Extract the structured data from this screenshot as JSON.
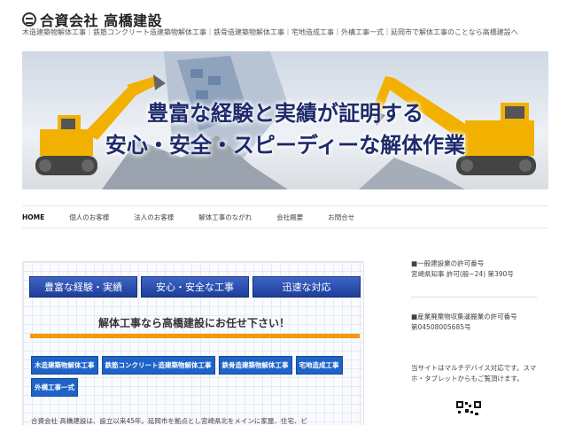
{
  "header": {
    "title": "合資会社 高橋建設",
    "description": "木造建築物解体工事｜鉄筋コンクリート造建築物解体工事｜鉄骨造建築物解体工事｜宅地造成工事｜外構工事一式｜延岡市で解体工事のことなら高橋建設へ"
  },
  "hero": {
    "line1": "豊富な経験と実績が証明する",
    "line2": "安心・安全・スピーディーな解体作業"
  },
  "nav": {
    "items": [
      "HOME",
      "個人のお客様",
      "法人のお客様",
      "解体工事のながれ",
      "会社概要",
      "お問合せ"
    ]
  },
  "content": {
    "headings": [
      "豊富な経験・実績",
      "安心・安全な工事",
      "迅速な対応"
    ],
    "promo": "解体工事なら高橋建設にお任せ下さい！",
    "services": [
      "木造建築物解体工事",
      "鉄筋コンクリート造建築物解体工事",
      "鉄骨造建築物解体工事",
      "宅地造成工事",
      "外構工事一式"
    ],
    "intro": "合資会社 高橋建設は、設立以来45年。延岡市を拠点とし宮崎県北をメインに家屋、住宅、ビ"
  },
  "sidebar": {
    "permit1_title": "■一般建設業の許可番号",
    "permit1_value": "宮崎県知事 許可(般−24) 第390号",
    "permit2_title": "■産業廃棄物収集運搬業の許可番号",
    "permit2_value": "第04508005685号",
    "multidevice_line1": "当サイトはマルチデバイス対応です。スマ",
    "multidevice_line2": "ホ・タブレットからもご覧頂けます。"
  },
  "colors": {
    "accent_blue": "#1e63c8",
    "accent_orange": "#f39800",
    "heading_navy": "#1d2a6b"
  }
}
